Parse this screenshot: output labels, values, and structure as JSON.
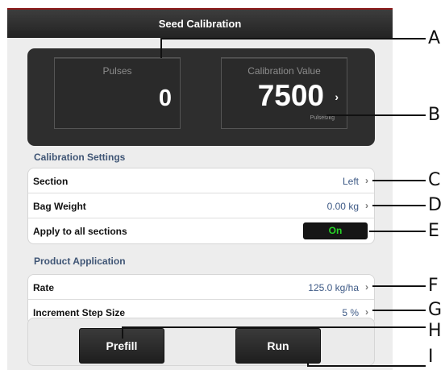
{
  "title": "Seed Calibration",
  "readouts": {
    "pulses_label": "Pulses",
    "pulses_value": "0",
    "cal_label": "Calibration Value",
    "cal_value": "7500",
    "cal_chevron": "›",
    "cal_unit": "Pulses/kg"
  },
  "calibration_settings": {
    "header": "Calibration Settings",
    "rows": [
      {
        "label": "Section",
        "value": "Left",
        "chevron": "›"
      },
      {
        "label": "Bag Weight",
        "value": "0.00 kg",
        "chevron": "›"
      },
      {
        "label": "Apply to all sections",
        "toggle": "On"
      }
    ]
  },
  "product_application": {
    "header": "Product Application",
    "rows": [
      {
        "label": "Rate",
        "value": "125.0 kg/ha",
        "chevron": "›"
      },
      {
        "label": "Increment Step Size",
        "value": "5 %",
        "chevron": "›"
      }
    ]
  },
  "buttons": {
    "prefill": "Prefill",
    "run": "Run"
  },
  "callouts": [
    "A",
    "B",
    "C",
    "D",
    "E",
    "F",
    "G",
    "H",
    "I"
  ],
  "colors": {
    "title_bar": "#232323",
    "title_accent": "#8b1a1a",
    "section_header": "#3f5575",
    "value_text": "#3e5a86",
    "toggle_on": "#27d627"
  }
}
